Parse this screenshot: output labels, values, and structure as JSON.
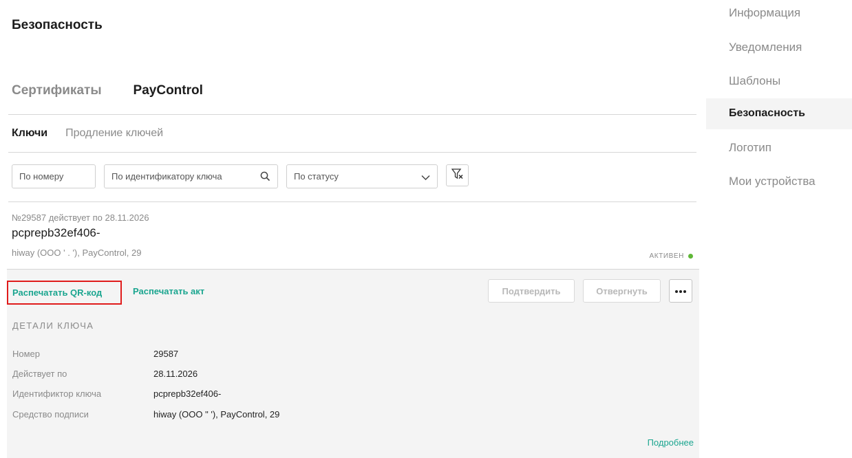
{
  "page": {
    "title": "Безопасность"
  },
  "tabs": [
    {
      "label": "Сертификаты",
      "active": false
    },
    {
      "label": "PayControl",
      "active": true
    }
  ],
  "subtabs": [
    {
      "label": "Ключи",
      "active": true
    },
    {
      "label": "Продление ключей",
      "active": false
    }
  ],
  "filters": {
    "by_number": "По номеру",
    "by_key_id": "По идентификатору ключа",
    "by_status": "По статусу",
    "icons": {
      "search": "search-icon",
      "dropdown": "chevron-down-icon",
      "reset": "filter-reset-icon"
    }
  },
  "item": {
    "subtitle": "№29587 действует по 28.11.2026",
    "key_id": "pcprepb32ef406-",
    "signature": "hiway (ООО '     .            '), PayControl, 29",
    "status": "АКТИВЕН",
    "status_color": "#5fb737"
  },
  "actions": {
    "print_qr": "Распечатать QR-код",
    "print_act": "Распечатать акт",
    "confirm": "Подтвердить",
    "reject": "Отвергнуть",
    "more": "•••"
  },
  "details": {
    "title": "ДЕТАЛИ КЛЮЧА",
    "rows": [
      {
        "label": "Номер",
        "value": "29587"
      },
      {
        "label": "Действует по",
        "value": "28.11.2026"
      },
      {
        "label": "Идентификтор ключа",
        "value": "pcprepb32ef406-"
      },
      {
        "label": "Средство подписи",
        "value": "hiway (ООО \"               '), PayControl, 29"
      }
    ],
    "more_link": "Подробнее"
  },
  "sidebar": {
    "items": [
      {
        "label": "Информация",
        "active": false
      },
      {
        "label": "Уведомления",
        "active": false
      },
      {
        "label": "Шаблоны",
        "active": false
      },
      {
        "label": "Безопасность",
        "active": true
      },
      {
        "label": "Логотип",
        "active": false
      },
      {
        "label": "Мои устройства",
        "active": false
      }
    ]
  },
  "colors": {
    "accent": "#1aa58f",
    "highlight_border": "#e01b1b",
    "panel_bg": "#f4f4f4"
  }
}
